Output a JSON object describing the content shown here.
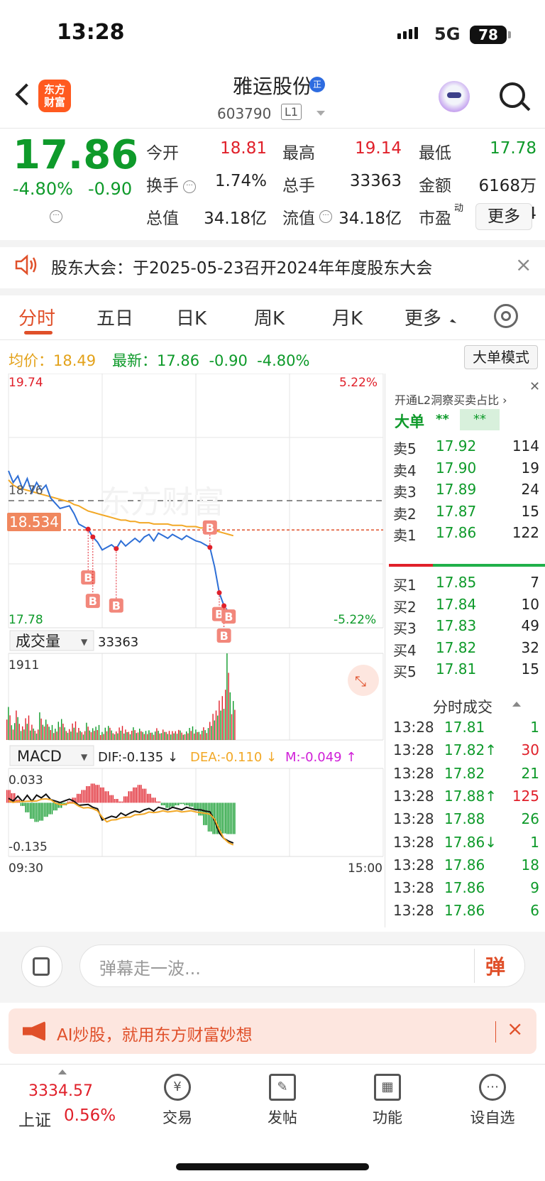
{
  "status_bar": {
    "time": "13:28",
    "network": "5G",
    "battery": "78"
  },
  "header": {
    "logo_text": "东方\n财富",
    "stock_name": "雅运股份",
    "badge": "正",
    "stock_code": "603790",
    "level": "L1"
  },
  "quote": {
    "price": "17.86",
    "change_pct": "-4.80%",
    "change": "-0.90",
    "rows": [
      [
        {
          "label": "今开",
          "value": "18.81",
          "color": "red"
        },
        {
          "label": "最高",
          "value": "19.14",
          "color": "red"
        },
        {
          "label": "最低",
          "value": "17.78",
          "color": "green"
        }
      ],
      [
        {
          "label": "换手",
          "value": "1.74%",
          "color": "dark"
        },
        {
          "label": "总手",
          "value": "33363",
          "color": "dark"
        },
        {
          "label": "金额",
          "value": "6168万",
          "color": "dark"
        }
      ],
      [
        {
          "label": "总值",
          "value": "34.18亿",
          "color": "dark"
        },
        {
          "label": "流值",
          "value": "34.18亿",
          "color": "dark"
        },
        {
          "label": "市盈",
          "value": "31.04",
          "color": "dark",
          "sup": "动"
        }
      ]
    ],
    "more_label": "更多"
  },
  "notice": {
    "text": "股东大会：于2025-05-23召开2024年年度股东大会",
    "close": "×"
  },
  "tabs": [
    "分时",
    "五日",
    "日K",
    "周K",
    "月K",
    "更多"
  ],
  "info_bar": {
    "avg_label": "均价：18.49",
    "latest_label": "最新：17.86  -0.90  -4.80%",
    "big_order_mode": "大单模式"
  },
  "chart_data": [
    {
      "type": "line",
      "name": "intraday",
      "y_top": "19.74",
      "y_bottom": "17.78",
      "pct_top": "5.22%",
      "pct_bottom": "-5.22%",
      "prev_close": "18.76",
      "current_line": "18.534",
      "ylim": [
        17.78,
        19.74
      ],
      "x_label_start": "09:30",
      "x_label_end": "15:00",
      "price": [
        18.99,
        18.9,
        18.95,
        18.85,
        18.93,
        18.82,
        18.9,
        18.84,
        18.88,
        18.78,
        18.74,
        18.7,
        18.71,
        18.72,
        18.66,
        18.58,
        18.56,
        18.54,
        18.48,
        18.44,
        18.38,
        18.4,
        18.42,
        18.39,
        18.45,
        18.41,
        18.44,
        18.47,
        18.44,
        18.48,
        18.5,
        18.45,
        18.51,
        18.49,
        18.47,
        18.5,
        18.48,
        18.46,
        18.49,
        18.47,
        18.45,
        18.44,
        18.42,
        18.4,
        18.25,
        18.05,
        17.95,
        17.9,
        17.86
      ],
      "avg": [
        18.92,
        18.88,
        18.86,
        18.85,
        18.84,
        18.83,
        18.82,
        18.81,
        18.8,
        18.79,
        18.78,
        18.77,
        18.76,
        18.75,
        18.73,
        18.72,
        18.7,
        18.68,
        18.67,
        18.66,
        18.65,
        18.64,
        18.63,
        18.62,
        18.61,
        18.61,
        18.6,
        18.6,
        18.59,
        18.59,
        18.59,
        18.58,
        18.58,
        18.58,
        18.58,
        18.57,
        18.57,
        18.57,
        18.56,
        18.56,
        18.56,
        18.55,
        18.55,
        18.54,
        18.53,
        18.52,
        18.51,
        18.5,
        18.49
      ],
      "buy_markers": [
        "B",
        "B",
        "B",
        "B",
        "B",
        "B",
        "B"
      ]
    },
    {
      "type": "bar",
      "name": "volume",
      "label": "成交量",
      "total": "33363",
      "max_label": "1911",
      "values": [
        820,
        420,
        650,
        300,
        540,
        380,
        260,
        610,
        450,
        330,
        280,
        520,
        360,
        240,
        410,
        300,
        220,
        380,
        260,
        330,
        200,
        350,
        270,
        190,
        310,
        260,
        230,
        280,
        250,
        200,
        240,
        210,
        260,
        230,
        200,
        220,
        250,
        210,
        190,
        300,
        260,
        230,
        280,
        400,
        650,
        980,
        1250,
        1911,
        860
      ]
    },
    {
      "type": "bar",
      "name": "macd",
      "label": "MACD",
      "dif": "DIF:-0.135 ↓",
      "dea": "DEA:-0.110 ↓",
      "m": "M:-0.049 ↑",
      "y_top": "0.033",
      "y_bottom": "-0.135",
      "values": [
        0.02,
        0.015,
        0.005,
        -0.005,
        -0.015,
        -0.025,
        -0.03,
        -0.028,
        -0.022,
        -0.018,
        -0.012,
        -0.008,
        -0.004,
        0.002,
        0.008,
        0.014,
        0.02,
        0.026,
        0.03,
        0.028,
        0.024,
        0.018,
        0.012,
        0.006,
        0.002,
        0.01,
        0.018,
        0.024,
        0.028,
        0.022,
        0.014,
        0.008,
        0.002,
        -0.004,
        -0.008,
        -0.006,
        -0.004,
        -0.002,
        -0.004,
        -0.006,
        -0.01,
        -0.02,
        -0.035,
        -0.045,
        -0.049,
        -0.049,
        -0.048,
        -0.049,
        -0.049
      ]
    }
  ],
  "order_panel": {
    "title": "开通L2洞察买卖占比 ›",
    "big_order": "大单",
    "big_order_v1": "**",
    "big_order_v2": "**",
    "asks": [
      {
        "label": "卖5",
        "price": "17.92",
        "vol": "114"
      },
      {
        "label": "卖4",
        "price": "17.90",
        "vol": "19"
      },
      {
        "label": "卖3",
        "price": "17.89",
        "vol": "24"
      },
      {
        "label": "卖2",
        "price": "17.87",
        "vol": "15"
      },
      {
        "label": "卖1",
        "price": "17.86",
        "vol": "122"
      }
    ],
    "bids": [
      {
        "label": "买1",
        "price": "17.85",
        "vol": "7"
      },
      {
        "label": "买2",
        "price": "17.84",
        "vol": "10"
      },
      {
        "label": "买3",
        "price": "17.83",
        "vol": "49"
      },
      {
        "label": "买4",
        "price": "17.82",
        "vol": "32"
      },
      {
        "label": "买5",
        "price": "17.81",
        "vol": "15"
      }
    ],
    "ticks_title": "分时成交",
    "ticks": [
      {
        "time": "13:28",
        "price": "17.81",
        "vol": "1",
        "pc": "green",
        "vc": "green"
      },
      {
        "time": "13:28",
        "price": "17.82↑",
        "vol": "30",
        "pc": "green",
        "vc": "red"
      },
      {
        "time": "13:28",
        "price": "17.82",
        "vol": "21",
        "pc": "green",
        "vc": "green"
      },
      {
        "time": "13:28",
        "price": "17.88↑",
        "vol": "125",
        "pc": "green",
        "vc": "red"
      },
      {
        "time": "13:28",
        "price": "17.88",
        "vol": "26",
        "pc": "green",
        "vc": "green"
      },
      {
        "time": "13:28",
        "price": "17.86↓",
        "vol": "1",
        "pc": "green",
        "vc": "green"
      },
      {
        "time": "13:28",
        "price": "17.86",
        "vol": "18",
        "pc": "green",
        "vc": "green"
      },
      {
        "time": "13:28",
        "price": "17.86",
        "vol": "9",
        "pc": "green",
        "vc": "green"
      },
      {
        "time": "13:28",
        "price": "17.86",
        "vol": "6",
        "pc": "green",
        "vc": "green"
      }
    ]
  },
  "comment_bar": {
    "placeholder": "弹幕走一波...",
    "send_label": "弹"
  },
  "ai_banner": {
    "text": "AI炒股，就用东方财富妙想",
    "close": "×"
  },
  "bottom_nav": {
    "index_value": "3334.57",
    "index_name": "上证",
    "index_pct": "0.56%",
    "items": [
      {
        "label": "交易",
        "icon": "yen-icon"
      },
      {
        "label": "发帖",
        "icon": "edit-icon"
      },
      {
        "label": "功能",
        "icon": "grid-icon"
      },
      {
        "label": "设自选",
        "icon": "dots-icon"
      }
    ]
  },
  "colors": {
    "up": "#e0202a",
    "down": "#0e9a2a",
    "avg": "#f2a826",
    "price": "#2e6fd6",
    "accent": "#e0502a"
  }
}
